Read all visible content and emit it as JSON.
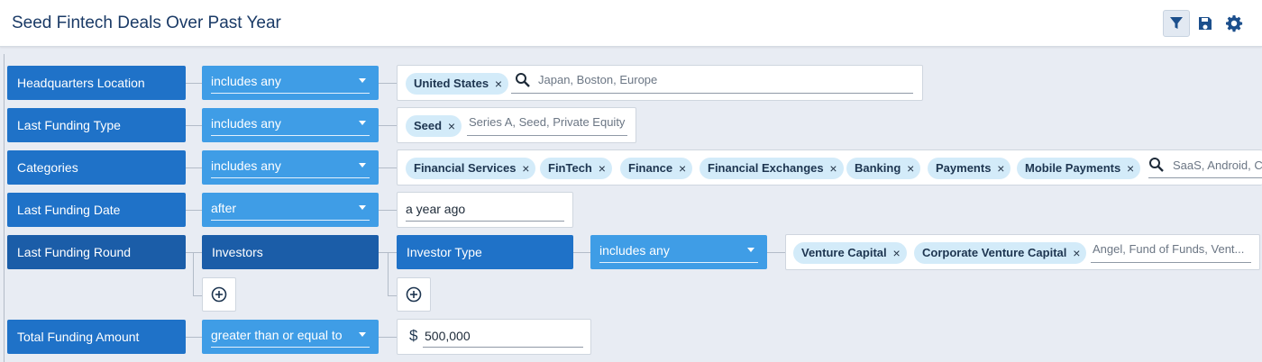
{
  "header": {
    "title": "Seed Fintech Deals Over Past Year",
    "icons": [
      "filter-icon",
      "save-icon",
      "gear-icon"
    ]
  },
  "filters": {
    "hq": {
      "label": "Headquarters Location",
      "operator": "includes any",
      "chips": [
        "United States"
      ],
      "placeholder": "Japan, Boston, Europe"
    },
    "funding_type": {
      "label": "Last Funding Type",
      "operator": "includes any",
      "chips": [
        "Seed"
      ],
      "placeholder": "Series A, Seed, Private Equity"
    },
    "categories": {
      "label": "Categories",
      "operator": "includes any",
      "chips": [
        "Financial Services",
        "FinTech",
        "Finance",
        "Financial Exchanges",
        "Banking",
        "Payments",
        "Mobile Payments"
      ],
      "placeholder": "SaaS, Android, C"
    },
    "funding_date": {
      "label": "Last Funding Date",
      "operator": "after",
      "value": "a year ago"
    },
    "funding_round": {
      "label": "Last Funding Round",
      "sub_label": "Investors",
      "sub_sub_label": "Investor Type",
      "operator": "includes any",
      "chips": [
        "Venture Capital",
        "Corporate Venture Capital"
      ],
      "placeholder": "Angel, Fund of Funds, Vent..."
    },
    "total_funding": {
      "label": "Total Funding Amount",
      "operator": "greater than or equal to",
      "currency": "$",
      "value": "500,000"
    }
  },
  "colors": {
    "label_blue": "#1f72c8",
    "operator_blue": "#3f9de6",
    "chip_bg": "#d3ebf9"
  }
}
